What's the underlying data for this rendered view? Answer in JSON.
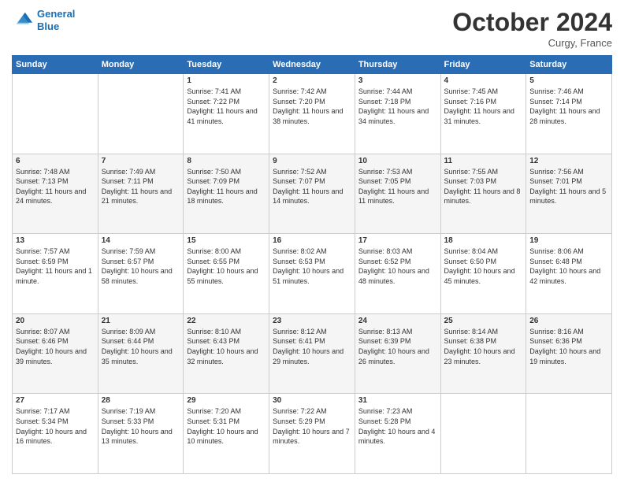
{
  "header": {
    "logo_line1": "General",
    "logo_line2": "Blue",
    "month_title": "October 2024",
    "location": "Curgy, France"
  },
  "days_of_week": [
    "Sunday",
    "Monday",
    "Tuesday",
    "Wednesday",
    "Thursday",
    "Friday",
    "Saturday"
  ],
  "weeks": [
    [
      {
        "day": "",
        "info": ""
      },
      {
        "day": "",
        "info": ""
      },
      {
        "day": "1",
        "info": "Sunrise: 7:41 AM\nSunset: 7:22 PM\nDaylight: 11 hours and 41 minutes."
      },
      {
        "day": "2",
        "info": "Sunrise: 7:42 AM\nSunset: 7:20 PM\nDaylight: 11 hours and 38 minutes."
      },
      {
        "day": "3",
        "info": "Sunrise: 7:44 AM\nSunset: 7:18 PM\nDaylight: 11 hours and 34 minutes."
      },
      {
        "day": "4",
        "info": "Sunrise: 7:45 AM\nSunset: 7:16 PM\nDaylight: 11 hours and 31 minutes."
      },
      {
        "day": "5",
        "info": "Sunrise: 7:46 AM\nSunset: 7:14 PM\nDaylight: 11 hours and 28 minutes."
      }
    ],
    [
      {
        "day": "6",
        "info": "Sunrise: 7:48 AM\nSunset: 7:13 PM\nDaylight: 11 hours and 24 minutes."
      },
      {
        "day": "7",
        "info": "Sunrise: 7:49 AM\nSunset: 7:11 PM\nDaylight: 11 hours and 21 minutes."
      },
      {
        "day": "8",
        "info": "Sunrise: 7:50 AM\nSunset: 7:09 PM\nDaylight: 11 hours and 18 minutes."
      },
      {
        "day": "9",
        "info": "Sunrise: 7:52 AM\nSunset: 7:07 PM\nDaylight: 11 hours and 14 minutes."
      },
      {
        "day": "10",
        "info": "Sunrise: 7:53 AM\nSunset: 7:05 PM\nDaylight: 11 hours and 11 minutes."
      },
      {
        "day": "11",
        "info": "Sunrise: 7:55 AM\nSunset: 7:03 PM\nDaylight: 11 hours and 8 minutes."
      },
      {
        "day": "12",
        "info": "Sunrise: 7:56 AM\nSunset: 7:01 PM\nDaylight: 11 hours and 5 minutes."
      }
    ],
    [
      {
        "day": "13",
        "info": "Sunrise: 7:57 AM\nSunset: 6:59 PM\nDaylight: 11 hours and 1 minute."
      },
      {
        "day": "14",
        "info": "Sunrise: 7:59 AM\nSunset: 6:57 PM\nDaylight: 10 hours and 58 minutes."
      },
      {
        "day": "15",
        "info": "Sunrise: 8:00 AM\nSunset: 6:55 PM\nDaylight: 10 hours and 55 minutes."
      },
      {
        "day": "16",
        "info": "Sunrise: 8:02 AM\nSunset: 6:53 PM\nDaylight: 10 hours and 51 minutes."
      },
      {
        "day": "17",
        "info": "Sunrise: 8:03 AM\nSunset: 6:52 PM\nDaylight: 10 hours and 48 minutes."
      },
      {
        "day": "18",
        "info": "Sunrise: 8:04 AM\nSunset: 6:50 PM\nDaylight: 10 hours and 45 minutes."
      },
      {
        "day": "19",
        "info": "Sunrise: 8:06 AM\nSunset: 6:48 PM\nDaylight: 10 hours and 42 minutes."
      }
    ],
    [
      {
        "day": "20",
        "info": "Sunrise: 8:07 AM\nSunset: 6:46 PM\nDaylight: 10 hours and 39 minutes."
      },
      {
        "day": "21",
        "info": "Sunrise: 8:09 AM\nSunset: 6:44 PM\nDaylight: 10 hours and 35 minutes."
      },
      {
        "day": "22",
        "info": "Sunrise: 8:10 AM\nSunset: 6:43 PM\nDaylight: 10 hours and 32 minutes."
      },
      {
        "day": "23",
        "info": "Sunrise: 8:12 AM\nSunset: 6:41 PM\nDaylight: 10 hours and 29 minutes."
      },
      {
        "day": "24",
        "info": "Sunrise: 8:13 AM\nSunset: 6:39 PM\nDaylight: 10 hours and 26 minutes."
      },
      {
        "day": "25",
        "info": "Sunrise: 8:14 AM\nSunset: 6:38 PM\nDaylight: 10 hours and 23 minutes."
      },
      {
        "day": "26",
        "info": "Sunrise: 8:16 AM\nSunset: 6:36 PM\nDaylight: 10 hours and 19 minutes."
      }
    ],
    [
      {
        "day": "27",
        "info": "Sunrise: 7:17 AM\nSunset: 5:34 PM\nDaylight: 10 hours and 16 minutes."
      },
      {
        "day": "28",
        "info": "Sunrise: 7:19 AM\nSunset: 5:33 PM\nDaylight: 10 hours and 13 minutes."
      },
      {
        "day": "29",
        "info": "Sunrise: 7:20 AM\nSunset: 5:31 PM\nDaylight: 10 hours and 10 minutes."
      },
      {
        "day": "30",
        "info": "Sunrise: 7:22 AM\nSunset: 5:29 PM\nDaylight: 10 hours and 7 minutes."
      },
      {
        "day": "31",
        "info": "Sunrise: 7:23 AM\nSunset: 5:28 PM\nDaylight: 10 hours and 4 minutes."
      },
      {
        "day": "",
        "info": ""
      },
      {
        "day": "",
        "info": ""
      }
    ]
  ]
}
